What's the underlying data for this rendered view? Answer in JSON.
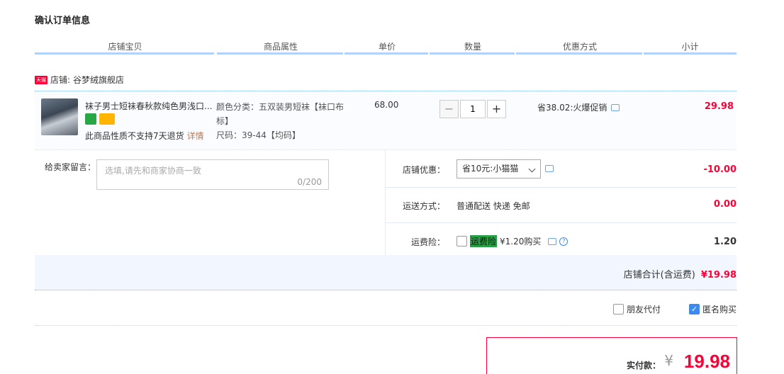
{
  "page": {
    "title": "确认订单信息"
  },
  "table_headers": [
    "店铺宝贝",
    "商品属性",
    "单价",
    "数量",
    "优惠方式",
    "小计"
  ],
  "shop": {
    "badge": "天猫",
    "label": "店铺:",
    "name": "谷梦绒旗舰店"
  },
  "item": {
    "title": "袜子男士短袜春秋款纯色男浅口...",
    "attributes": [
      "颜色分类：五双装男短袜【袜口布标】",
      "尺码：39-44【均码】"
    ],
    "no_return_notice": "此商品性质不支持7天退货",
    "detail_link": "详情",
    "unit_price": "68.00",
    "quantity": "1",
    "qty_minus": "−",
    "qty_plus": "+",
    "promo": "省38.02:火爆促销",
    "subtotal": "29.98"
  },
  "message": {
    "label": "给卖家留言：",
    "placeholder": "选填,请先和商家协商一致",
    "counter": "0/200"
  },
  "shop_discount": {
    "label": "店铺优惠：",
    "selected": "省10元:小猫猫",
    "amount": "-10.00"
  },
  "shipping": {
    "label": "运送方式：",
    "value": "普通配送 快递 免邮",
    "amount": "0.00"
  },
  "insurance": {
    "label": "运费险：",
    "tag": "运费险",
    "price": "¥1.20购买",
    "help": "?",
    "amount": "1.20"
  },
  "shop_total": {
    "label": "店铺合计(含运费)",
    "amount": "¥19.98"
  },
  "options": {
    "friend_pay": "朋友代付",
    "anonymous": "匿名购买",
    "anonymous_checked": true,
    "friend_checked": false
  },
  "payment": {
    "label": "实付款：",
    "currency": "¥",
    "amount": "19.98"
  },
  "colors": {
    "accent_red": "#ff0036",
    "header_bar": "#b2d1ff",
    "checkbox_blue": "#3c8af0"
  }
}
